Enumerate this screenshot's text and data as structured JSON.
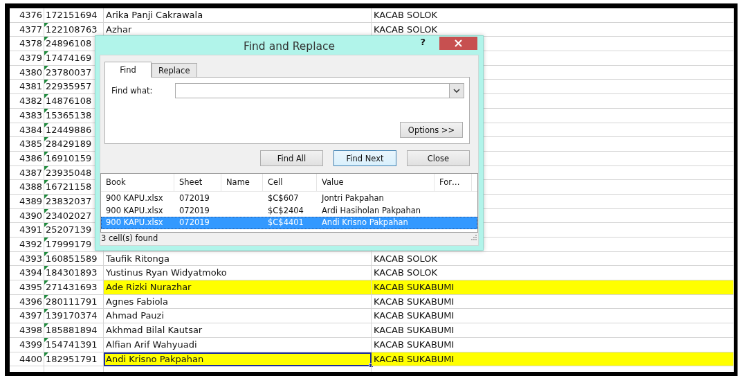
{
  "sheet": {
    "rows": [
      {
        "row": "4376",
        "id": "172151694",
        "name": "Arika Panji Cakrawala",
        "unit": "KACAB SOLOK",
        "error_flag": false,
        "highlighted": false,
        "selected": false
      },
      {
        "row": "4377",
        "id": "122108763",
        "name": "Azhar",
        "unit": "KACAB SOLOK",
        "error_flag": true,
        "highlighted": false,
        "selected": false
      },
      {
        "row": "4378",
        "id": "24896108",
        "error_flag": true
      },
      {
        "row": "4379",
        "id": "17474169",
        "error_flag": true
      },
      {
        "row": "4380",
        "id": "23780037",
        "error_flag": true
      },
      {
        "row": "4381",
        "id": "22935957",
        "error_flag": true
      },
      {
        "row": "4382",
        "id": "14876108",
        "error_flag": true
      },
      {
        "row": "4383",
        "id": "15365138",
        "error_flag": true
      },
      {
        "row": "4384",
        "id": "12449886",
        "error_flag": true
      },
      {
        "row": "4385",
        "id": "28429189",
        "error_flag": true
      },
      {
        "row": "4386",
        "id": "16910159",
        "error_flag": true
      },
      {
        "row": "4387",
        "id": "23935048",
        "error_flag": true
      },
      {
        "row": "4388",
        "id": "16721158",
        "error_flag": true
      },
      {
        "row": "4389",
        "id": "23832037",
        "error_flag": true
      },
      {
        "row": "4390",
        "id": "23402027",
        "error_flag": true
      },
      {
        "row": "4391",
        "id": "25207139",
        "error_flag": true
      },
      {
        "row": "4392",
        "id": "17999179",
        "error_flag": true
      },
      {
        "row": "4393",
        "id": "160851589",
        "name": "Taufik Ritonga",
        "unit": "KACAB SOLOK",
        "error_flag": true,
        "highlighted": false,
        "selected": false
      },
      {
        "row": "4394",
        "id": "184301893",
        "name": "Yustinus Ryan Widyatmoko",
        "unit": "KACAB SOLOK",
        "error_flag": true,
        "highlighted": false,
        "selected": false
      },
      {
        "row": "4395",
        "id": "271431693",
        "name": "Ade Rizki Nurazhar",
        "unit": "KACAB SUKABUMI",
        "error_flag": true,
        "highlighted": true,
        "selected": false
      },
      {
        "row": "4396",
        "id": "280111791",
        "name": "Agnes Fabiola",
        "unit": "KACAB SUKABUMI",
        "error_flag": true,
        "highlighted": false,
        "selected": false
      },
      {
        "row": "4397",
        "id": "139170374",
        "name": "Ahmad Pauzi",
        "unit": "KACAB SUKABUMI",
        "error_flag": true,
        "highlighted": false,
        "selected": false
      },
      {
        "row": "4398",
        "id": "185881894",
        "name": "Akhmad Bilal Kautsar",
        "unit": "KACAB SUKABUMI",
        "error_flag": true,
        "highlighted": false,
        "selected": false
      },
      {
        "row": "4399",
        "id": "154741391",
        "name": "Alfian Arif Wahyuadi",
        "unit": "KACAB SUKABUMI",
        "error_flag": true,
        "highlighted": false,
        "selected": false
      },
      {
        "row": "4400",
        "id": "182951791",
        "name": "Andi Krisno Pakpahan",
        "unit": "KACAB SUKABUMI",
        "error_flag": true,
        "highlighted": true,
        "selected": true
      }
    ]
  },
  "dialog": {
    "title": "Find and Replace",
    "help": "?",
    "tabs": [
      {
        "label": "Find",
        "selected": true
      },
      {
        "label": "Replace",
        "selected": false
      }
    ],
    "find_what": {
      "label": "Find what:"
    },
    "options_button": "Options >>",
    "buttons": [
      {
        "label": "Find All",
        "default": false
      },
      {
        "label": "Find Next",
        "default": true
      },
      {
        "label": "Close",
        "default": false
      }
    ],
    "results": {
      "columns": [
        "Book",
        "Sheet",
        "Name",
        "Cell",
        "Value",
        "For…"
      ],
      "rows": [
        {
          "book": "900 KAPU.xlsx",
          "sheet": "072019",
          "cell": "$C$607",
          "value": "Jontri Pakpahan",
          "selected": false
        },
        {
          "book": "900 KAPU.xlsx",
          "sheet": "072019",
          "cell": "$C$2404",
          "value": "Ardi Hasiholan Pakpahan",
          "selected": false
        },
        {
          "book": "900 KAPU.xlsx",
          "sheet": "072019",
          "cell": "$C$4401",
          "value": "Andi Krisno Pakpahan",
          "selected": true
        }
      ]
    },
    "status": "3 cell(s) found"
  }
}
